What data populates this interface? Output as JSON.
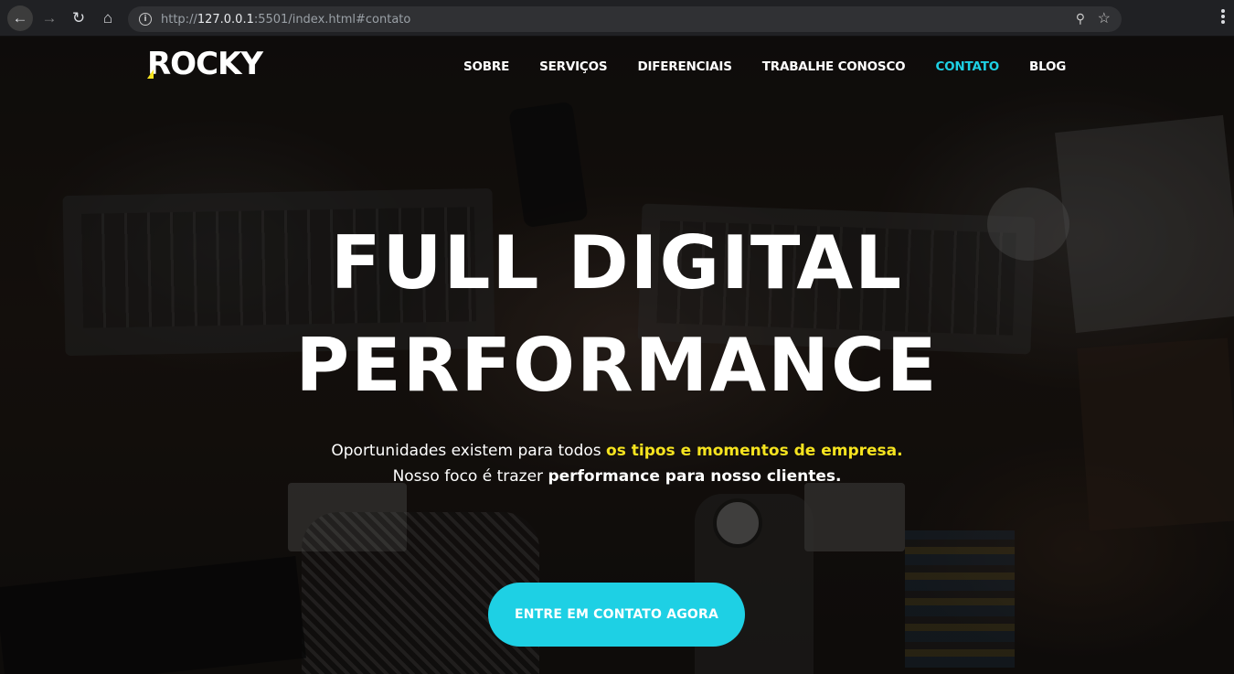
{
  "browser": {
    "url_scheme": "http://",
    "url_host": "127.0.0.1",
    "url_rest": ":5501/index.html#contato",
    "icons": {
      "back": "back-arrow-icon",
      "forward": "forward-arrow-icon",
      "reload": "reload-icon",
      "home": "home-icon",
      "info": "info-icon",
      "zoom": "zoom-icon",
      "bookmark": "star-icon",
      "menu": "kebab-menu-icon"
    }
  },
  "site": {
    "logo": "ROCKY",
    "nav": [
      {
        "label": "SOBRE"
      },
      {
        "label": "SERVIÇOS"
      },
      {
        "label": "DIFERENCIAIS"
      },
      {
        "label": "TRABALHE CONOSCO"
      },
      {
        "label": "CONTATO",
        "active": true
      },
      {
        "label": "BLOG"
      }
    ],
    "headline_line1": "FULL DIGITAL",
    "headline_line2": "PERFORMANCE",
    "sub_line1_prefix": "Oportunidades existem para todos ",
    "sub_line1_highlight": "os tipos e momentos de empresa.",
    "sub_line2_prefix": "Nosso foco é trazer ",
    "sub_line2_bold": "performance para nosso clientes.",
    "cta_label": "ENTRE EM CONTATO AGORA"
  },
  "colors": {
    "accent_cyan": "#1ed0e4",
    "accent_yellow": "#f5e31f",
    "chrome_bg": "#202124"
  }
}
